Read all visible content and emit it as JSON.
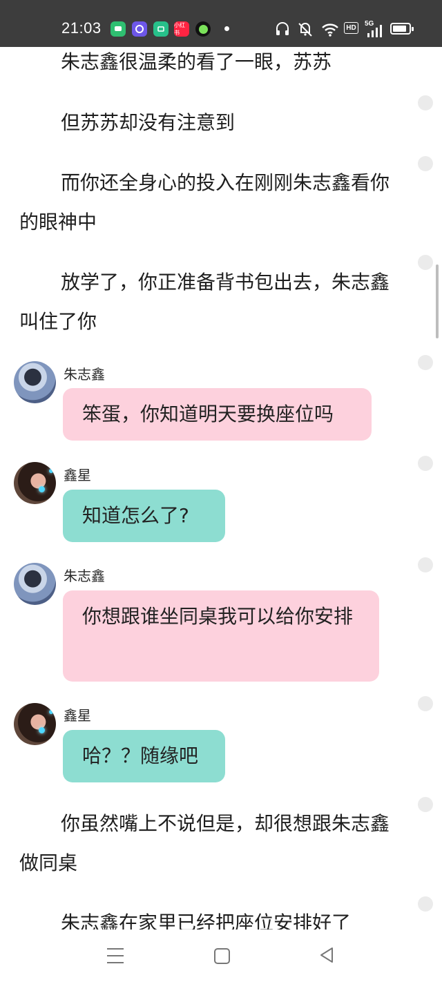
{
  "status_bar": {
    "time": "21:03",
    "app_icons": [
      {
        "icon": "messages-app-icon",
        "color": "#2fbf71"
      },
      {
        "icon": "browser-app-icon",
        "color": "#6d57e8"
      },
      {
        "icon": "wallet-app-icon",
        "color": "#27c08a"
      },
      {
        "icon": "xiaohongshu-app-icon",
        "label": "小红书",
        "color": "#ff2442"
      },
      {
        "icon": "green-circle-app-icon",
        "color": "#1ba04b"
      }
    ],
    "hd_label": "HD",
    "network_label": "5G",
    "battery_level": 0.75
  },
  "story": {
    "para_1": "朱志鑫很温柔的看了一眼，苏苏",
    "para_2": "但苏苏却没有注意到",
    "para_3": "而你还全身心的投入在刚刚朱志鑫看你的眼神中",
    "para_4": "放学了，你正准备背书包出去，朱志鑫叫住了你",
    "para_5": "你虽然嘴上不说但是，却很想跟朱志鑫做同桌",
    "para_6": "朱志鑫在家里已经把座位安排好了"
  },
  "messages": [
    {
      "sender": "朱志鑫",
      "text": "笨蛋，你知道明天要换座位吗"
    },
    {
      "sender": "鑫星",
      "text": "知道怎么了?"
    },
    {
      "sender": "朱志鑫",
      "text": "你想跟谁坐同桌我可以给你安排"
    },
    {
      "sender": "鑫星",
      "text": "哈？？随缘吧"
    }
  ],
  "colors": {
    "status_bar_bg": "#3d3d3d",
    "bubble_pink": "#fdd1dd",
    "bubble_teal": "#8dddd1"
  }
}
